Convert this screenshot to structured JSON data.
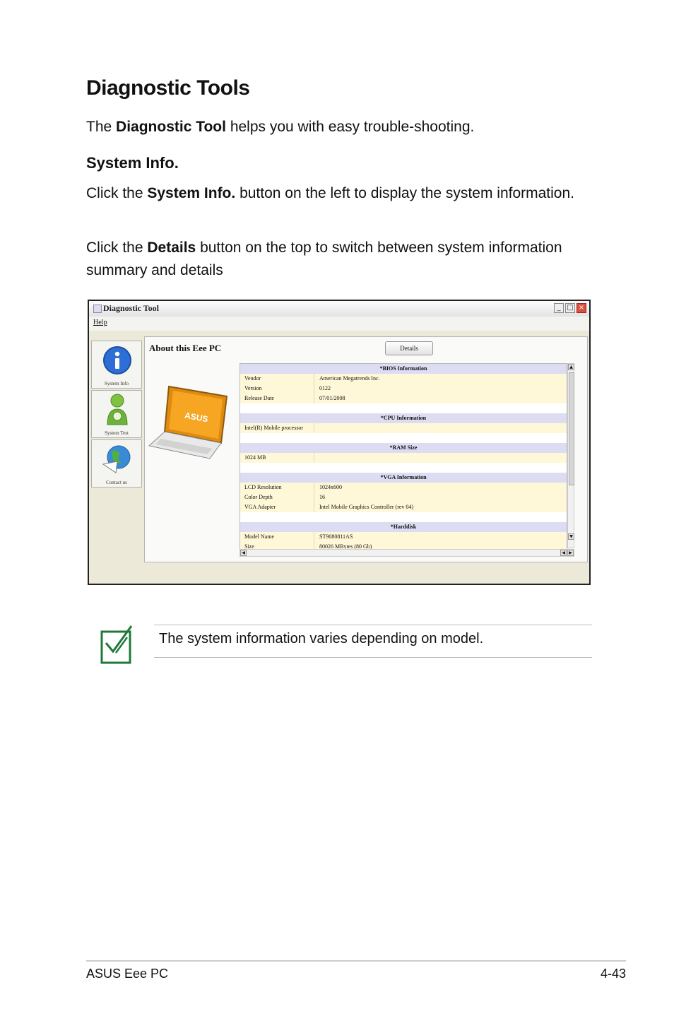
{
  "heading": "Diagnostic Tools",
  "intro": {
    "pre": "The ",
    "bold": "Diagnostic Tool",
    "post": " helps you with easy trouble-shooting."
  },
  "subheading": "System Info.",
  "para1": {
    "pre": "Click the ",
    "bold": "System Info.",
    "post": " button on the left to display the system information."
  },
  "para2": {
    "pre": "Click the ",
    "bold": "Details",
    "post": " button on the top to switch between system information summary and details"
  },
  "window": {
    "title": "Diagnostic Tool",
    "menu_help": "Help",
    "about_title": "About this Eee PC",
    "details_button": "Details",
    "sidebar": [
      "System Info",
      "System Test",
      "Contact us"
    ],
    "laptop_logo": "ASUS",
    "rows": [
      {
        "type": "sect",
        "label": "*BIOS Information"
      },
      {
        "type": "data",
        "k": "Vendor",
        "v": "American Megatrends Inc."
      },
      {
        "type": "data",
        "k": "Version",
        "v": "0122"
      },
      {
        "type": "data",
        "k": "Release Date",
        "v": "07/01/2008"
      },
      {
        "type": "blank"
      },
      {
        "type": "sect",
        "label": "*CPU Information"
      },
      {
        "type": "data",
        "k": "Intel(R) Mobile processor",
        "v": ""
      },
      {
        "type": "blank"
      },
      {
        "type": "sect",
        "label": "*RAM Size"
      },
      {
        "type": "data",
        "k": "1024 MB",
        "v": ""
      },
      {
        "type": "blank"
      },
      {
        "type": "sect",
        "label": "*VGA Information"
      },
      {
        "type": "data",
        "k": "LCD Resolution",
        "v": "1024x600"
      },
      {
        "type": "data",
        "k": "Color Depth",
        "v": "16"
      },
      {
        "type": "data",
        "k": "VGA Adapter",
        "v": "Intel Mobile Graphics Controller (rev 04)"
      },
      {
        "type": "blank"
      },
      {
        "type": "sect",
        "label": "*Harddisk"
      },
      {
        "type": "data",
        "k": "Model Name",
        "v": "ST9080811AS"
      },
      {
        "type": "data",
        "k": "Size",
        "v": "80026 MBytes (80 Gb)"
      }
    ]
  },
  "note": "The system information varies depending on model.",
  "footer": {
    "left": "ASUS Eee PC",
    "right": "4-43"
  },
  "colors": {
    "note_icon": "#1f7a3a",
    "section_row": "#dcdcf2",
    "data_row": "#fff8d8"
  }
}
